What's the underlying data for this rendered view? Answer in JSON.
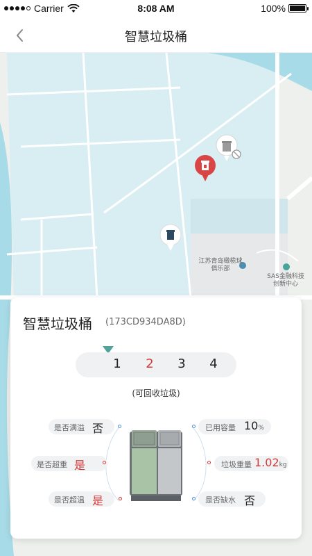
{
  "status_bar": {
    "carrier": "Carrier",
    "time": "8:08 AM",
    "battery": "100%"
  },
  "nav": {
    "title": "智慧垃圾桶"
  },
  "map": {
    "labels": [
      {
        "text": "江苏青岛橄榄球"
      },
      {
        "text": "俱乐部"
      },
      {
        "text": "SAS金融科技"
      },
      {
        "text": "创新中心"
      }
    ]
  },
  "card": {
    "title": "智慧垃圾桶",
    "device_id": "(173CD934DA8D)",
    "bins": [
      "1",
      "2",
      "3",
      "4"
    ],
    "selected_bin": "1",
    "bin_type": "(可回收垃圾)",
    "left_stats": [
      {
        "label": "是否满溢",
        "value": "否"
      },
      {
        "label": "是否超重",
        "value": "是"
      },
      {
        "label": "是否超温",
        "value": "是"
      }
    ],
    "right_stats": [
      {
        "label": "已用容量",
        "value": "10",
        "unit": "%"
      },
      {
        "label": "垃圾重量",
        "value": "1.02",
        "unit": "kg"
      },
      {
        "label": "是否缺水",
        "value": "否"
      }
    ]
  },
  "colors": {
    "accent_red": "#d43a3a",
    "accent_teal": "#53a39a",
    "map_water": "#d8eef3",
    "map_river": "#a8dbe8"
  }
}
